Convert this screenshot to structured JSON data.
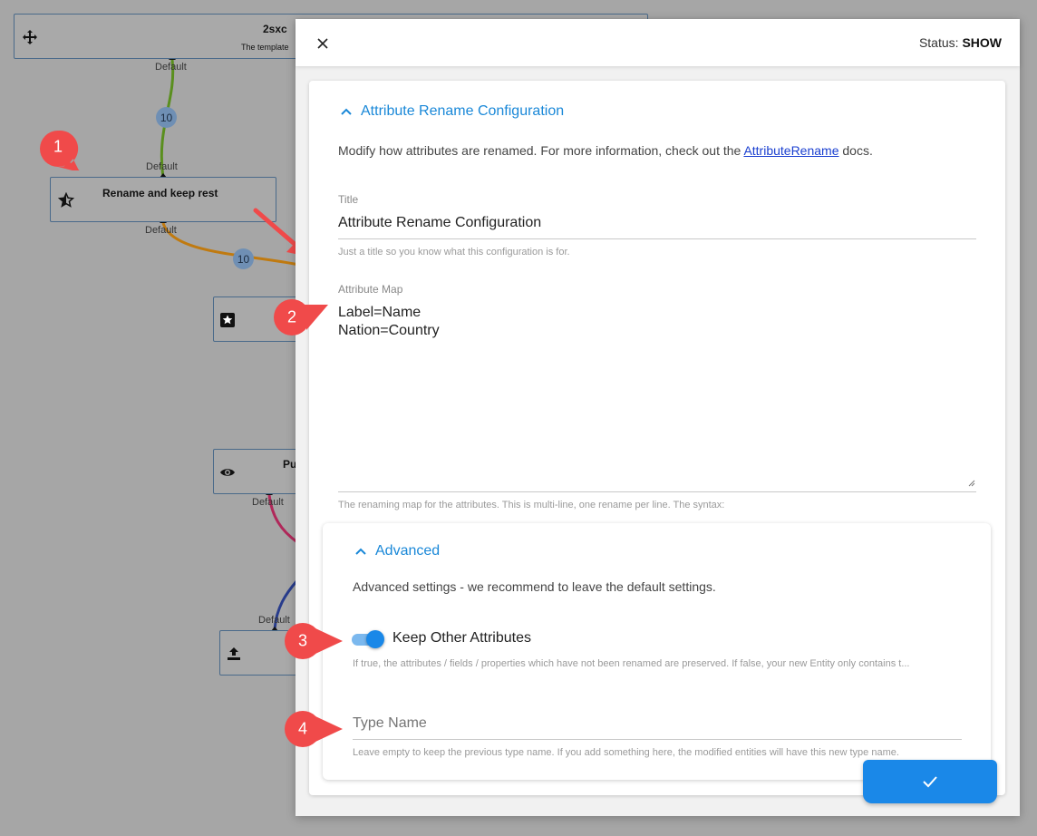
{
  "canvas": {
    "nodes": [
      {
        "title": "2sxc",
        "subtitle": "The template",
        "icon": "crosshair-move-icon"
      },
      {
        "title": "Rename and keep rest",
        "icon": "star-half-icon"
      },
      {
        "title": "",
        "icon": "star-box-icon"
      },
      {
        "title": "Pu",
        "icon": "eye-icon"
      },
      {
        "title": "",
        "icon": "upload-icon"
      }
    ],
    "port_labels": [
      "Default",
      "Default",
      "Default",
      "Default",
      "Default"
    ],
    "badges": [
      "10",
      "10"
    ],
    "link_colors": {
      "green": "#5a8f1e",
      "orange": "#c07a10",
      "crimson": "#b0285a",
      "navy": "#283c8c"
    }
  },
  "markers": [
    "1",
    "2",
    "3",
    "4"
  ],
  "marker_color": "#f04a4a",
  "dialog": {
    "close_icon": "close-icon",
    "status_label": "Status:",
    "status_value": "SHOW",
    "section": {
      "title": "Attribute Rename Configuration",
      "description_prefix": "Modify how attributes are renamed. For more information, check out the ",
      "description_link": "AttributeRename",
      "description_suffix": " docs."
    },
    "title_field": {
      "label": "Title",
      "value": "Attribute Rename Configuration",
      "hint": "Just a title so you know what this configuration is for."
    },
    "map_field": {
      "label": "Attribute Map",
      "value": "Label=Name\nNation=Country",
      "hint": "The renaming map for the attributes. This is multi-line, one rename per line. The syntax:"
    },
    "advanced": {
      "title": "Advanced",
      "description": "Advanced settings - we recommend to leave the default settings.",
      "toggle_label": "Keep Other Attributes",
      "toggle_on": true,
      "toggle_hint": "If true, the attributes / fields / properties which have not been renamed are preserved. If false, your new Entity only contains t...",
      "type_name_placeholder": "Type Name",
      "type_name_hint": "Leave empty to keep the previous type name. If you add something here, the modified entities will have this new type name."
    },
    "save_icon": "check-icon",
    "accent_color": "#1a88e8"
  }
}
